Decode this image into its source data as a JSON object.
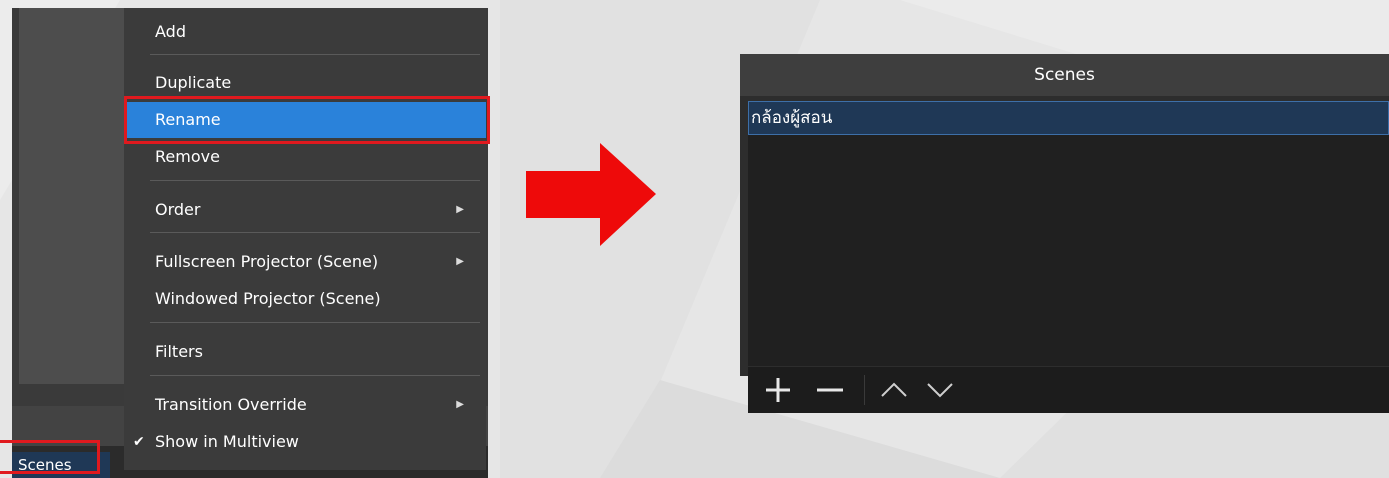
{
  "context_menu": {
    "items": [
      {
        "label": "Add"
      },
      {
        "label": "Duplicate"
      },
      {
        "label": "Rename"
      },
      {
        "label": "Remove"
      },
      {
        "label": "Order"
      },
      {
        "label": "Fullscreen Projector (Scene)"
      },
      {
        "label": "Windowed Projector (Scene)"
      },
      {
        "label": "Filters"
      },
      {
        "label": "Transition Override"
      },
      {
        "label": "Show in Multiview"
      }
    ],
    "highlighted": "Rename"
  },
  "left_panel": {
    "scenes_tab_label": "Scenes"
  },
  "scenes_dock": {
    "title": "Scenes",
    "scenes": [
      {
        "name": "กล้องผู้สอน"
      }
    ]
  },
  "colors": {
    "highlight": "#2a82da",
    "annotation": "#e0191e",
    "selected_row": "#1f3856"
  },
  "icons": [
    "plus-icon",
    "minus-icon",
    "chevron-up-icon",
    "chevron-down-icon",
    "submenu-arrow-icon",
    "checkmark-icon",
    "right-arrow-annotation"
  ]
}
